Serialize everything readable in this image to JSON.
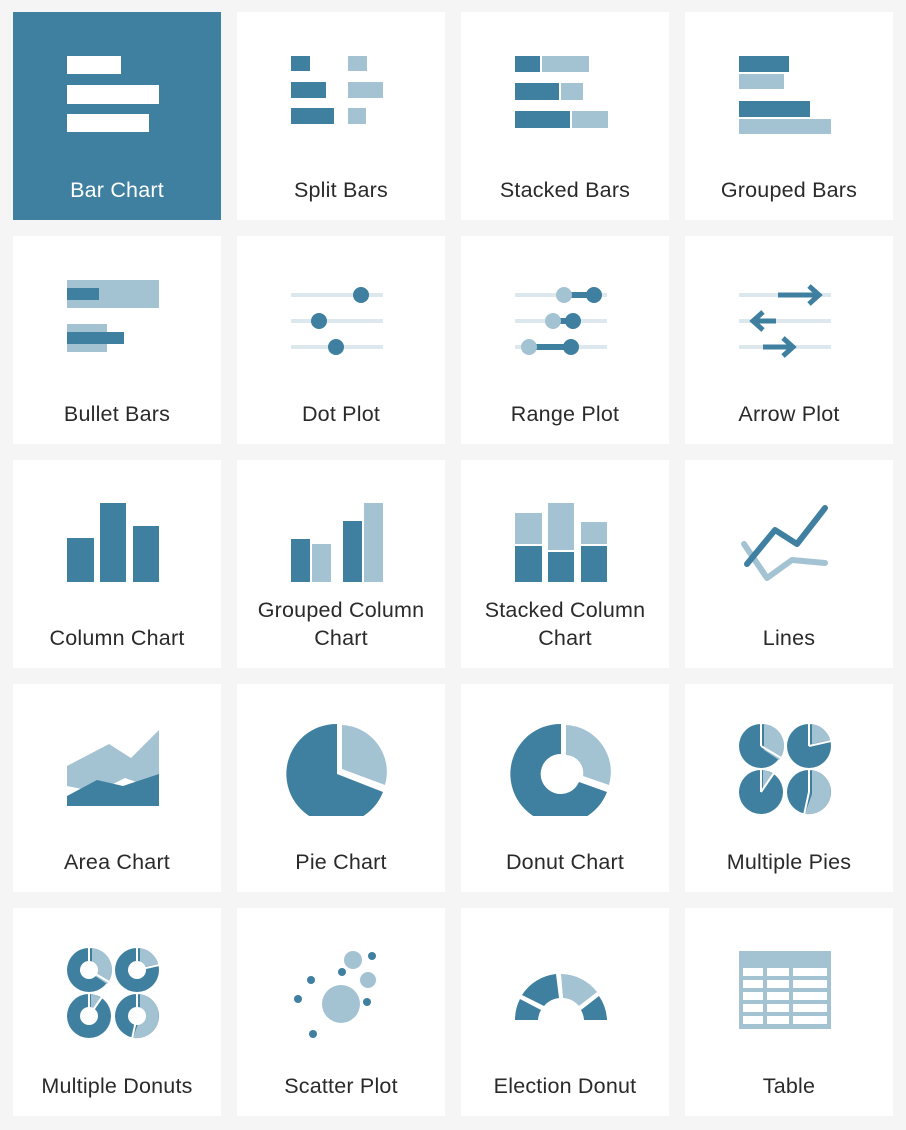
{
  "colors": {
    "dark": "#3f7fa0",
    "light": "#a3c3d3",
    "pale": "#dce8ee",
    "selected_bg": "#3f7fa0",
    "text": "#2a2a2a"
  },
  "tiles": [
    {
      "label": "Bar Chart",
      "icon": "bar-chart-icon",
      "selected": true
    },
    {
      "label": "Split Bars",
      "icon": "split-bars-icon"
    },
    {
      "label": "Stacked Bars",
      "icon": "stacked-bars-icon"
    },
    {
      "label": "Grouped Bars",
      "icon": "grouped-bars-icon"
    },
    {
      "label": "Bullet Bars",
      "icon": "bullet-bars-icon"
    },
    {
      "label": "Dot Plot",
      "icon": "dot-plot-icon"
    },
    {
      "label": "Range Plot",
      "icon": "range-plot-icon"
    },
    {
      "label": "Arrow Plot",
      "icon": "arrow-plot-icon"
    },
    {
      "label": "Column Chart",
      "icon": "column-chart-icon"
    },
    {
      "label": "Grouped Column Chart",
      "icon": "grouped-column-chart-icon"
    },
    {
      "label": "Stacked Column Chart",
      "icon": "stacked-column-chart-icon"
    },
    {
      "label": "Lines",
      "icon": "lines-icon"
    },
    {
      "label": "Area Chart",
      "icon": "area-chart-icon"
    },
    {
      "label": "Pie Chart",
      "icon": "pie-chart-icon"
    },
    {
      "label": "Donut Chart",
      "icon": "donut-chart-icon"
    },
    {
      "label": "Multiple Pies",
      "icon": "multiple-pies-icon"
    },
    {
      "label": "Multiple Donuts",
      "icon": "multiple-donuts-icon"
    },
    {
      "label": "Scatter Plot",
      "icon": "scatter-plot-icon"
    },
    {
      "label": "Election Donut",
      "icon": "election-donut-icon"
    },
    {
      "label": "Table",
      "icon": "table-icon"
    }
  ]
}
